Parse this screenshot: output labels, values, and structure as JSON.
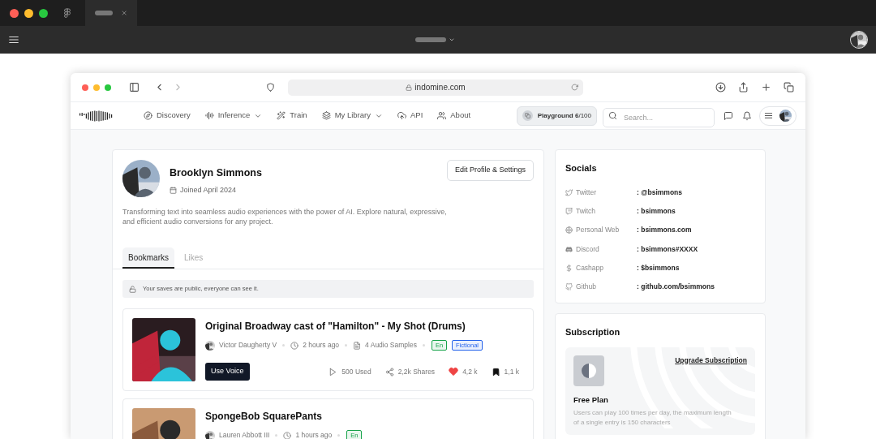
{
  "browser": {
    "url": "indomine.com"
  },
  "nav": {
    "items": [
      {
        "label": "Discovery",
        "dropdown": false
      },
      {
        "label": "Inference",
        "dropdown": true
      },
      {
        "label": "Train",
        "dropdown": false
      },
      {
        "label": "My Library",
        "dropdown": true
      },
      {
        "label": "API",
        "dropdown": false
      },
      {
        "label": "About",
        "dropdown": false
      }
    ],
    "playground": "**Playground 6**/100",
    "search": {
      "placeholder": "Search..."
    }
  },
  "profile": {
    "name": "Brooklyn Simmons",
    "joined": "Joined April 2024",
    "bio": "Transforming text into seamless audio experiences with the power of AI. Explore natural, expressive, and efficient audio conversions for any project.",
    "edit_button": "Edit Profile & Settings"
  },
  "tabs": [
    {
      "label": "Bookmarks",
      "selected": true
    },
    {
      "label": "Likes",
      "selected": false
    }
  ],
  "notice": "Your saves are public, everyone can see it.",
  "voices": [
    {
      "title": "Original Broadway cast of \"Hamilton\" - My Shot (Drums)",
      "author": "Victor Daugherty V",
      "time": "2 hours ago",
      "samples": "4 Audio Samples",
      "tags": [
        {
          "label": "En",
          "color": "#16a34a"
        },
        {
          "label": "Fictional",
          "color": "#2563eb"
        }
      ],
      "button": "Use Voice",
      "used": "500 Used",
      "shares": "2,2k Shares",
      "likes": "4,2 k",
      "liked": true,
      "bookmarks": "1,1 k",
      "bookmarked": true
    },
    {
      "title": "SpongeBob SquarePants",
      "author": "Lauren Abbott III",
      "time": "1 hours ago",
      "tags": [
        {
          "label": "En",
          "color": "#16a34a"
        }
      ]
    }
  ],
  "socials": {
    "title": "Socials",
    "items": [
      {
        "label": "Twitter",
        "value": ": @bsimmons"
      },
      {
        "label": "Twitch",
        "value": ": bsimmons"
      },
      {
        "label": "Personal Web",
        "value": ": bsimmons.com"
      },
      {
        "label": "Discord",
        "value": ": bsimmons#XXXX"
      },
      {
        "label": "Cashapp",
        "value": ": $bsimmons"
      },
      {
        "label": "Github",
        "value": ": github.com/bsimmons"
      }
    ]
  },
  "subscription": {
    "title": "Subscription",
    "link": "Upgrade Subscription",
    "plan": "Free Plan",
    "description": "Users can play 100 times per day, the maximum length of a single entry is 150 characters"
  }
}
